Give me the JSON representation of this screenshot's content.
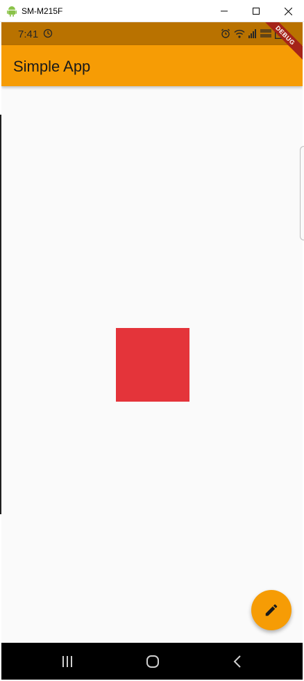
{
  "window": {
    "title": "SM-M215F",
    "minimize_icon": "minimize-icon",
    "maximize_icon": "maximize-icon",
    "close_icon": "close-icon"
  },
  "statusbar": {
    "time": "7:41",
    "icons": [
      "sync-icon",
      "alarm-icon",
      "wifi-icon",
      "signal-icon",
      "lte-icon",
      "battery-icon"
    ],
    "color": "#b97200"
  },
  "appbar": {
    "title": "Simple App",
    "color": "#f69c05"
  },
  "debug_banner": {
    "label": "DEBUG",
    "color": "#a52419"
  },
  "content": {
    "square_color": "#e4343a",
    "background": "#fafafa"
  },
  "fab": {
    "icon": "edit-icon",
    "color": "#f69c05"
  },
  "navbar": {
    "buttons": [
      "recents-icon",
      "home-icon",
      "back-icon"
    ]
  }
}
